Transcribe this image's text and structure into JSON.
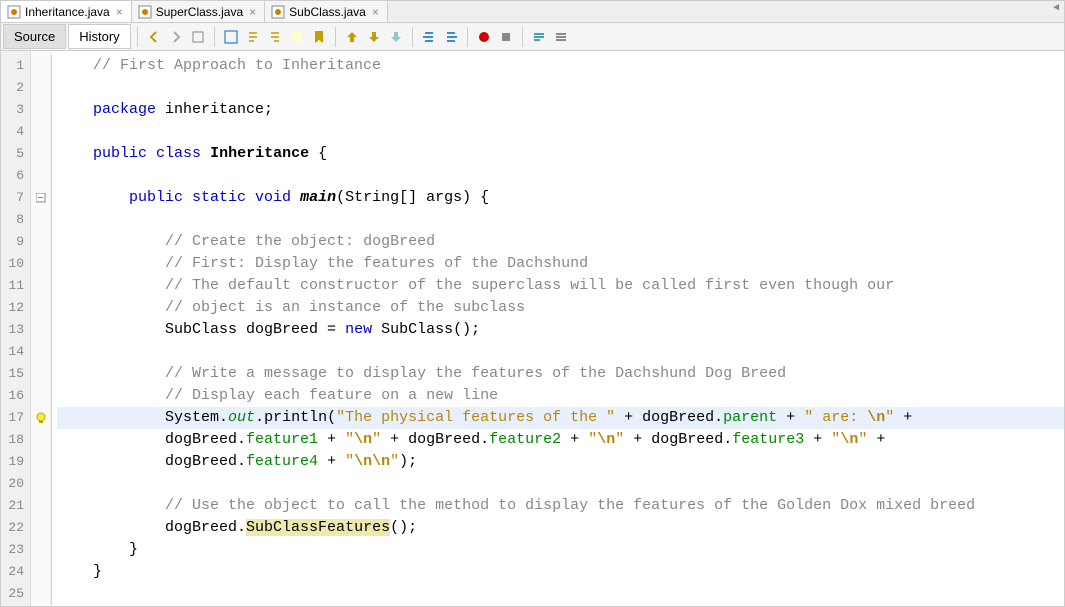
{
  "tabs": [
    {
      "label": "Inheritance.java",
      "active": true
    },
    {
      "label": "SuperClass.java",
      "active": false
    },
    {
      "label": "SubClass.java",
      "active": false
    }
  ],
  "viewTabs": {
    "source": "Source",
    "history": "History"
  },
  "code": {
    "l1": "// First Approach to Inheritance",
    "l3_kw": "package",
    "l3_rest": " inheritance;",
    "l5_kw1": "public",
    "l5_kw2": "class",
    "l5_cls": "Inheritance",
    "l5_end": " {",
    "l7_kw": "public static void",
    "l7_m": "main",
    "l7_rest": "(String[] args) {",
    "l9": "// Create the object: dogBreed",
    "l10": "// First: Display the features of the Dachshund",
    "l11": "// The default constructor of the superclass will be called first even though our",
    "l12": "// object is an instance of the subclass",
    "l13_a": "SubClass dogBreed = ",
    "l13_kw": "new",
    "l13_b": " SubClass();",
    "l15": "// Write a message to display the features of the Dachshund Dog Breed",
    "l16": "// Display each feature on a new line",
    "l17_a": "System.",
    "l17_out": "out",
    "l17_b": ".println(",
    "l17_s1": "\"The physical features of the \"",
    "l17_c": " + dogBreed.",
    "l17_parent": "parent",
    "l17_d": " + ",
    "l17_s2b": "\" are: ",
    "l17_esc1": "\\n",
    "l17_s2e": "\"",
    "l17_e": " +",
    "l18_a": "dogBreed.",
    "l18_f1": "feature1",
    "l18_b": " + ",
    "l18_s1b": "\"",
    "l18_e1": "\\n",
    "l18_s1e": "\"",
    "l18_c": " + dogBreed.",
    "l18_f2": "feature2",
    "l18_d": " + ",
    "l18_s2b": "\"",
    "l18_e2": "\\n",
    "l18_s2e": "\"",
    "l18_e": " + dogBreed.",
    "l18_f3": "feature3",
    "l18_f": " + ",
    "l18_s3b": "\"",
    "l18_e3": "\\n",
    "l18_s3e": "\"",
    "l18_g": " +",
    "l19_a": "dogBreed.",
    "l19_f4": "feature4",
    "l19_b": " + ",
    "l19_s1b": "\"",
    "l19_e1": "\\n\\n",
    "l19_s1e": "\"",
    "l19_c": ");",
    "l21": "// Use the object to call the method to display the features of the Golden Dox mixed breed",
    "l22_a": "dogBreed.",
    "l22_w": "SubClassFeatures",
    "l22_b": "();",
    "l23": "}",
    "l24": "}"
  },
  "lineCount": 25
}
